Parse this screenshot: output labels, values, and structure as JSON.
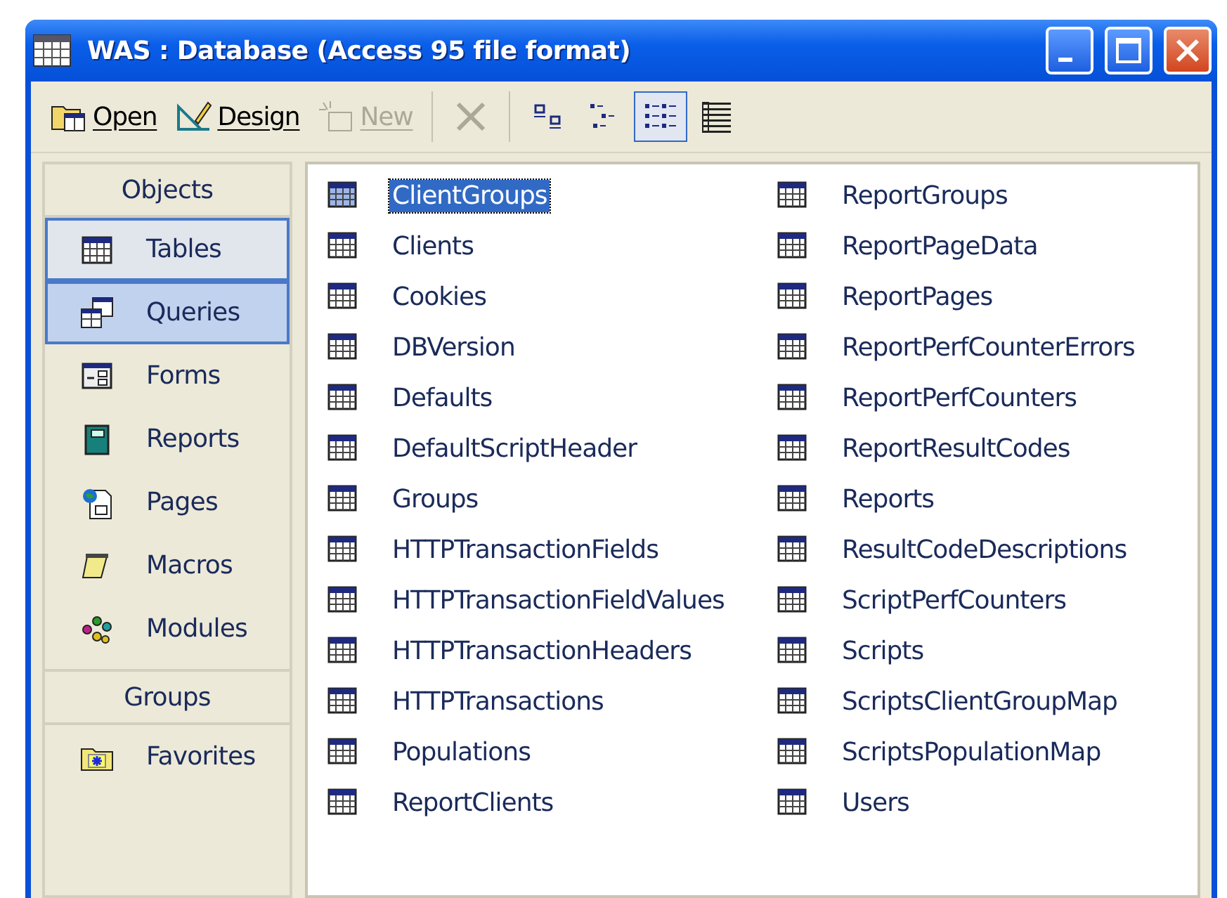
{
  "window": {
    "title": "WAS : Database (Access 95 file format)"
  },
  "toolbar": {
    "buttons": [
      {
        "kind": "open",
        "label": "Open",
        "disabled": false,
        "pressed": false
      },
      {
        "kind": "design",
        "label": "Design",
        "disabled": false,
        "pressed": false
      },
      {
        "kind": "new",
        "label": "New",
        "disabled": true,
        "pressed": false
      },
      {
        "kind": "delete",
        "disabled": true,
        "pressed": false
      },
      {
        "kind": "large-icons",
        "disabled": false,
        "pressed": false
      },
      {
        "kind": "small-icons",
        "disabled": false,
        "pressed": false
      },
      {
        "kind": "list",
        "disabled": false,
        "pressed": true
      },
      {
        "kind": "details",
        "disabled": false,
        "pressed": false
      }
    ]
  },
  "objects_bar": {
    "header": "Objects",
    "items": [
      {
        "kind": "table",
        "label": "Tables",
        "selected": true,
        "hovered": false
      },
      {
        "kind": "query",
        "label": "Queries",
        "selected": false,
        "hovered": true
      },
      {
        "kind": "form",
        "label": "Forms",
        "selected": false,
        "hovered": false
      },
      {
        "kind": "report",
        "label": "Reports",
        "selected": false,
        "hovered": false
      },
      {
        "kind": "page",
        "label": "Pages",
        "selected": false,
        "hovered": false
      },
      {
        "kind": "macro",
        "label": "Macros",
        "selected": false,
        "hovered": false
      },
      {
        "kind": "module",
        "label": "Modules",
        "selected": false,
        "hovered": false
      }
    ],
    "groups_header": "Groups",
    "groups": [
      {
        "label": "Favorites"
      }
    ]
  },
  "list": {
    "items": [
      {
        "label": "ClientGroups",
        "selected": true
      },
      {
        "label": "Clients",
        "selected": false
      },
      {
        "label": "Cookies",
        "selected": false
      },
      {
        "label": "DBVersion",
        "selected": false
      },
      {
        "label": "Defaults",
        "selected": false
      },
      {
        "label": "DefaultScriptHeader",
        "selected": false
      },
      {
        "label": "Groups",
        "selected": false
      },
      {
        "label": "HTTPTransactionFields",
        "selected": false
      },
      {
        "label": "HTTPTransactionFieldValues",
        "selected": false
      },
      {
        "label": "HTTPTransactionHeaders",
        "selected": false
      },
      {
        "label": "HTTPTransactions",
        "selected": false
      },
      {
        "label": "Populations",
        "selected": false
      },
      {
        "label": "ReportClients",
        "selected": false
      },
      {
        "label": "ReportGroups",
        "selected": false
      },
      {
        "label": "ReportPageData",
        "selected": false
      },
      {
        "label": "ReportPages",
        "selected": false
      },
      {
        "label": "ReportPerfCounterErrors",
        "selected": false
      },
      {
        "label": "ReportPerfCounters",
        "selected": false
      },
      {
        "label": "ReportResultCodes",
        "selected": false
      },
      {
        "label": "Reports",
        "selected": false
      },
      {
        "label": "ResultCodeDescriptions",
        "selected": false
      },
      {
        "label": "ScriptPerfCounters",
        "selected": false
      },
      {
        "label": "Scripts",
        "selected": false
      },
      {
        "label": "ScriptsClientGroupMap",
        "selected": false
      },
      {
        "label": "ScriptsPopulationMap",
        "selected": false
      },
      {
        "label": "Users",
        "selected": false
      }
    ]
  }
}
